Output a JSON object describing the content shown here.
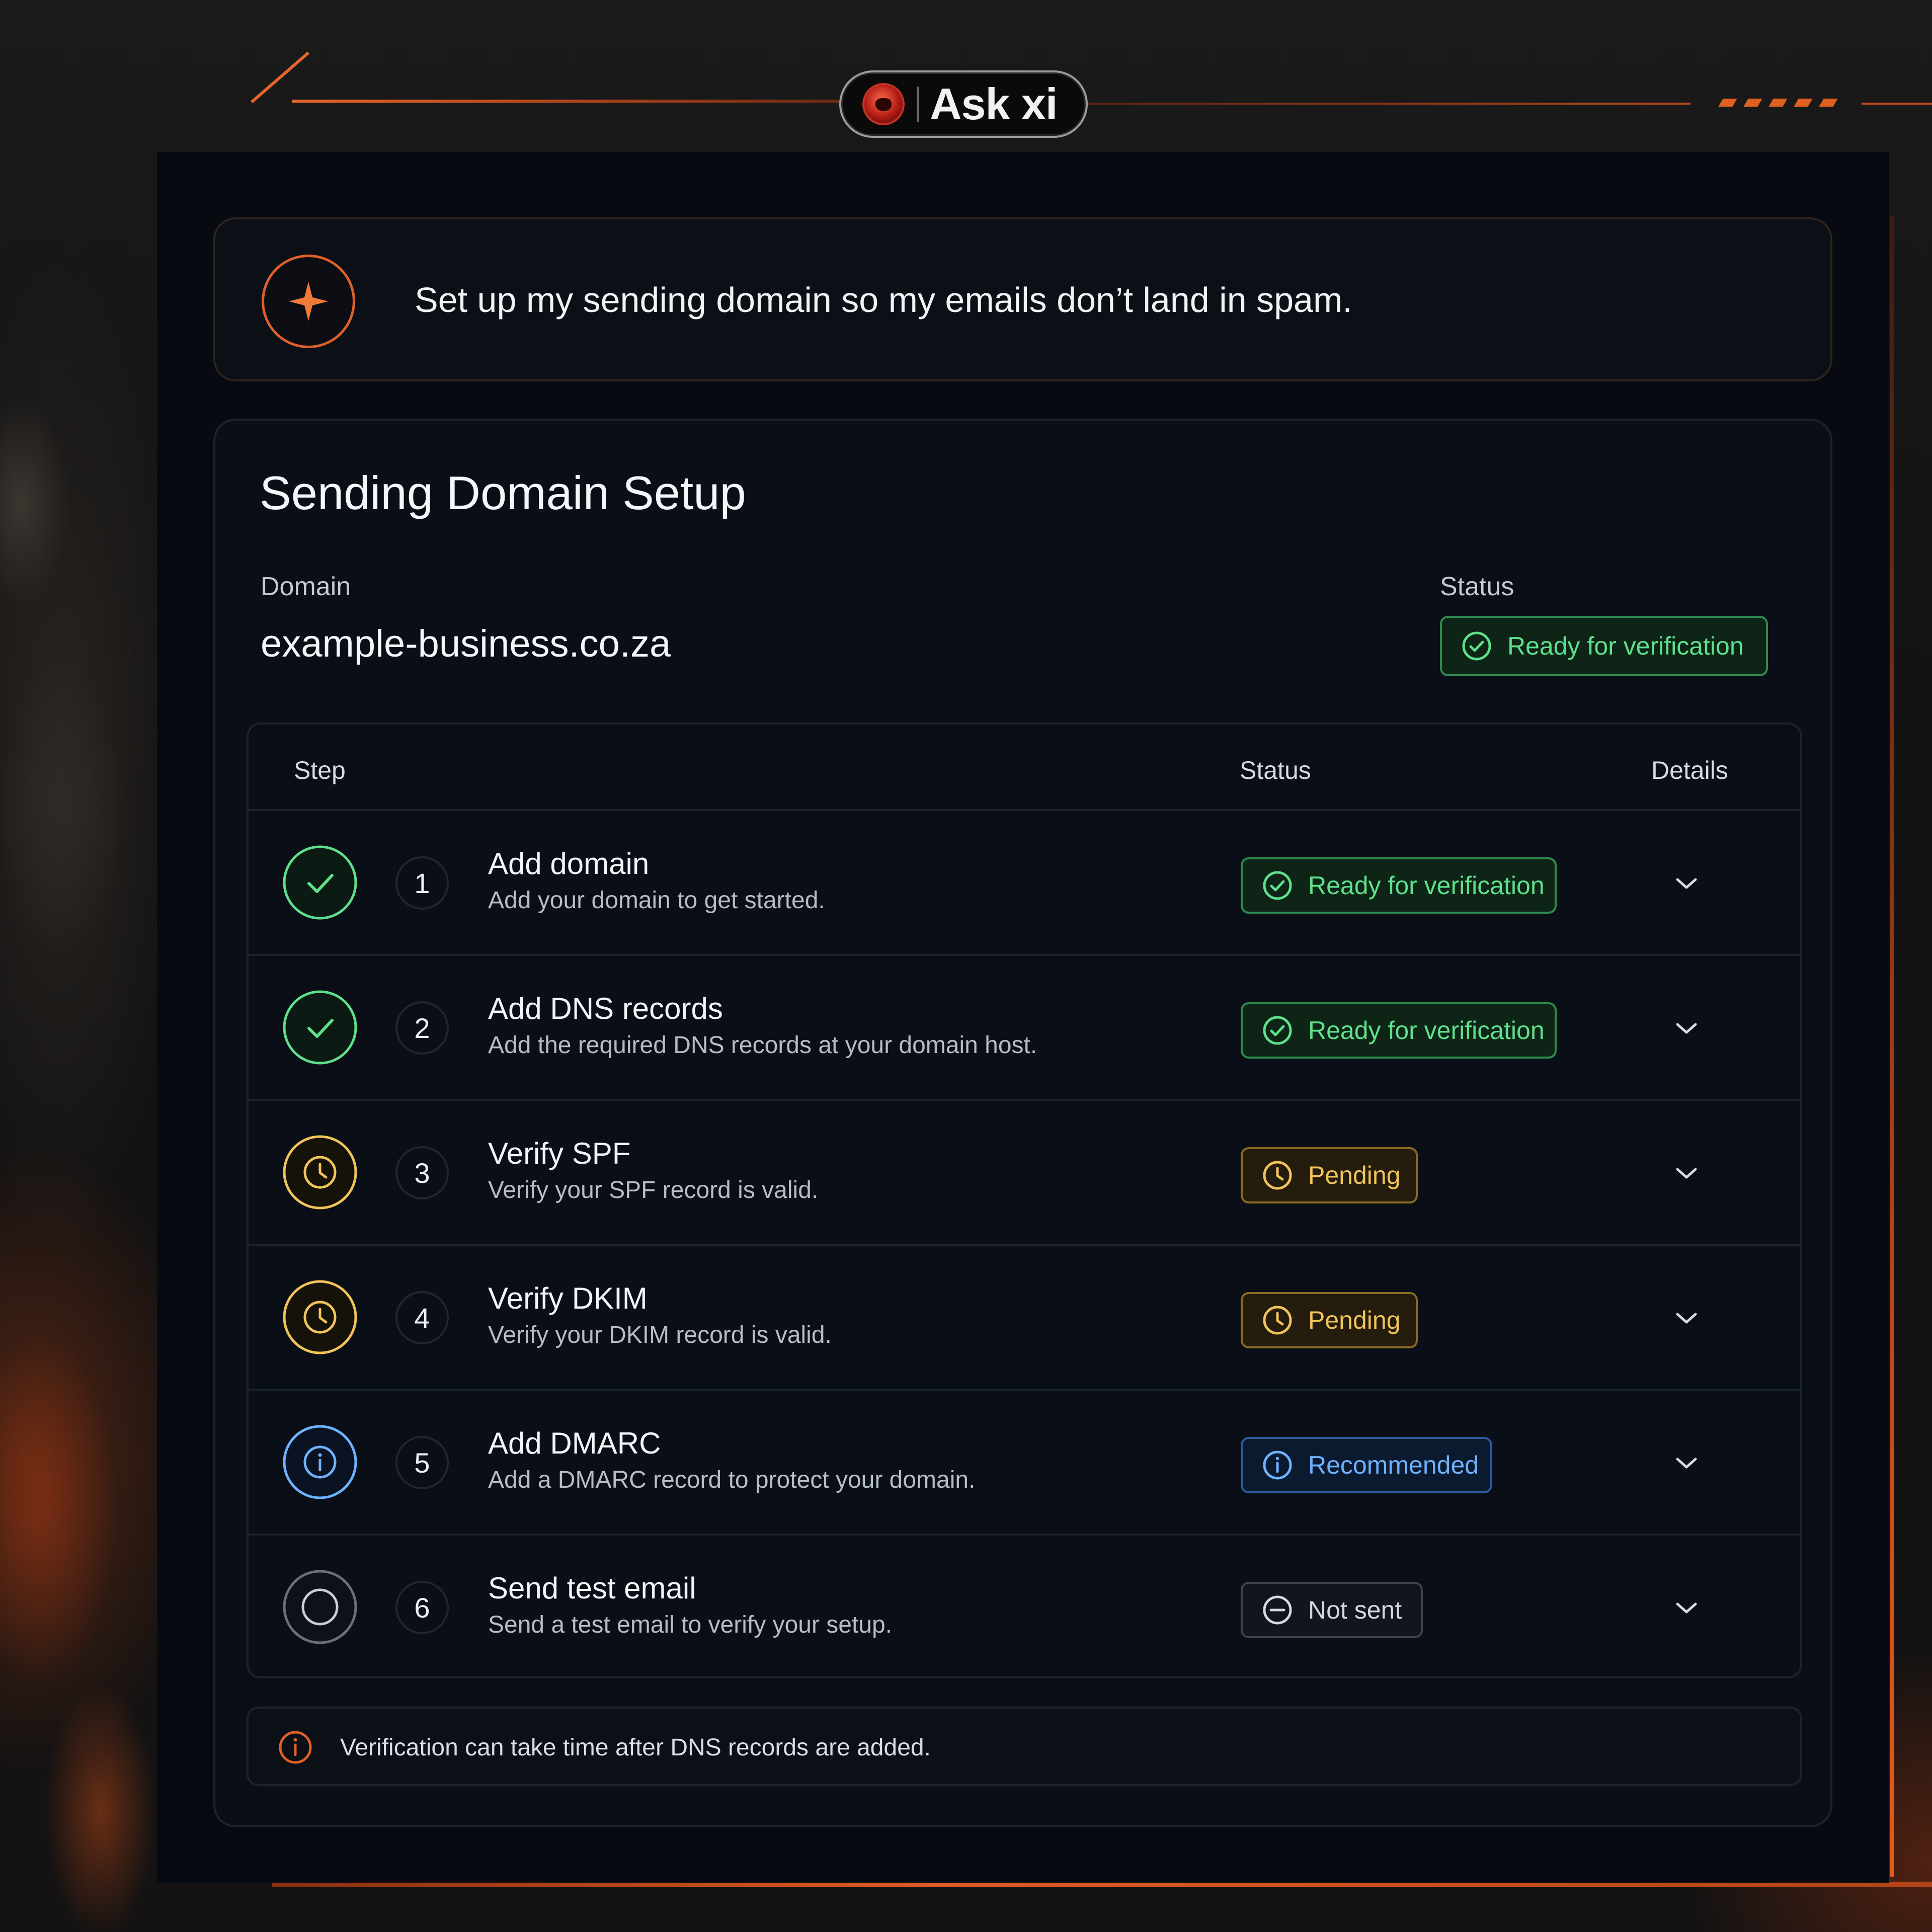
{
  "brand": {
    "name": "Ask xi"
  },
  "prompt": {
    "text": "Set up my sending domain so my emails don’t land in spam."
  },
  "setup": {
    "title": "Sending Domain Setup",
    "domain_label": "Domain",
    "domain_value": "example-business.co.za",
    "status_label": "Status",
    "status_value": "Ready for verification"
  },
  "table": {
    "headers": {
      "step": "Step",
      "status": "Status",
      "details": "Details"
    },
    "rows": [
      {
        "num": "1",
        "title": "Add domain",
        "desc": "Add your domain to get started.",
        "status": "Ready for verification",
        "state": "complete"
      },
      {
        "num": "2",
        "title": "Add DNS records",
        "desc": "Add the required DNS records at your domain host.",
        "status": "Ready for verification",
        "state": "complete"
      },
      {
        "num": "3",
        "title": "Verify SPF",
        "desc": "Verify your SPF record is valid.",
        "status": "Pending",
        "state": "pending"
      },
      {
        "num": "4",
        "title": "Verify DKIM",
        "desc": "Verify your DKIM record is valid.",
        "status": "Pending",
        "state": "pending"
      },
      {
        "num": "5",
        "title": "Add DMARC",
        "desc": "Add a DMARC record to protect your domain.",
        "status": "Recommended",
        "state": "recommended"
      },
      {
        "num": "6",
        "title": "Send test email",
        "desc": "Send a test email to verify your setup.",
        "status": "Not sent",
        "state": "not-sent"
      }
    ]
  },
  "note": {
    "text": "Verification can take time after DNS records are added."
  },
  "colors": {
    "accent": "#e0602a",
    "success": "#5fe08c",
    "pending": "#f2c45a",
    "info": "#6fb2ff",
    "muted": "#d4d8e0"
  },
  "icons": {
    "complete": "check-circle-icon",
    "pending": "clock-icon",
    "recommended": "info-icon",
    "not-sent": "empty-circle-icon"
  }
}
